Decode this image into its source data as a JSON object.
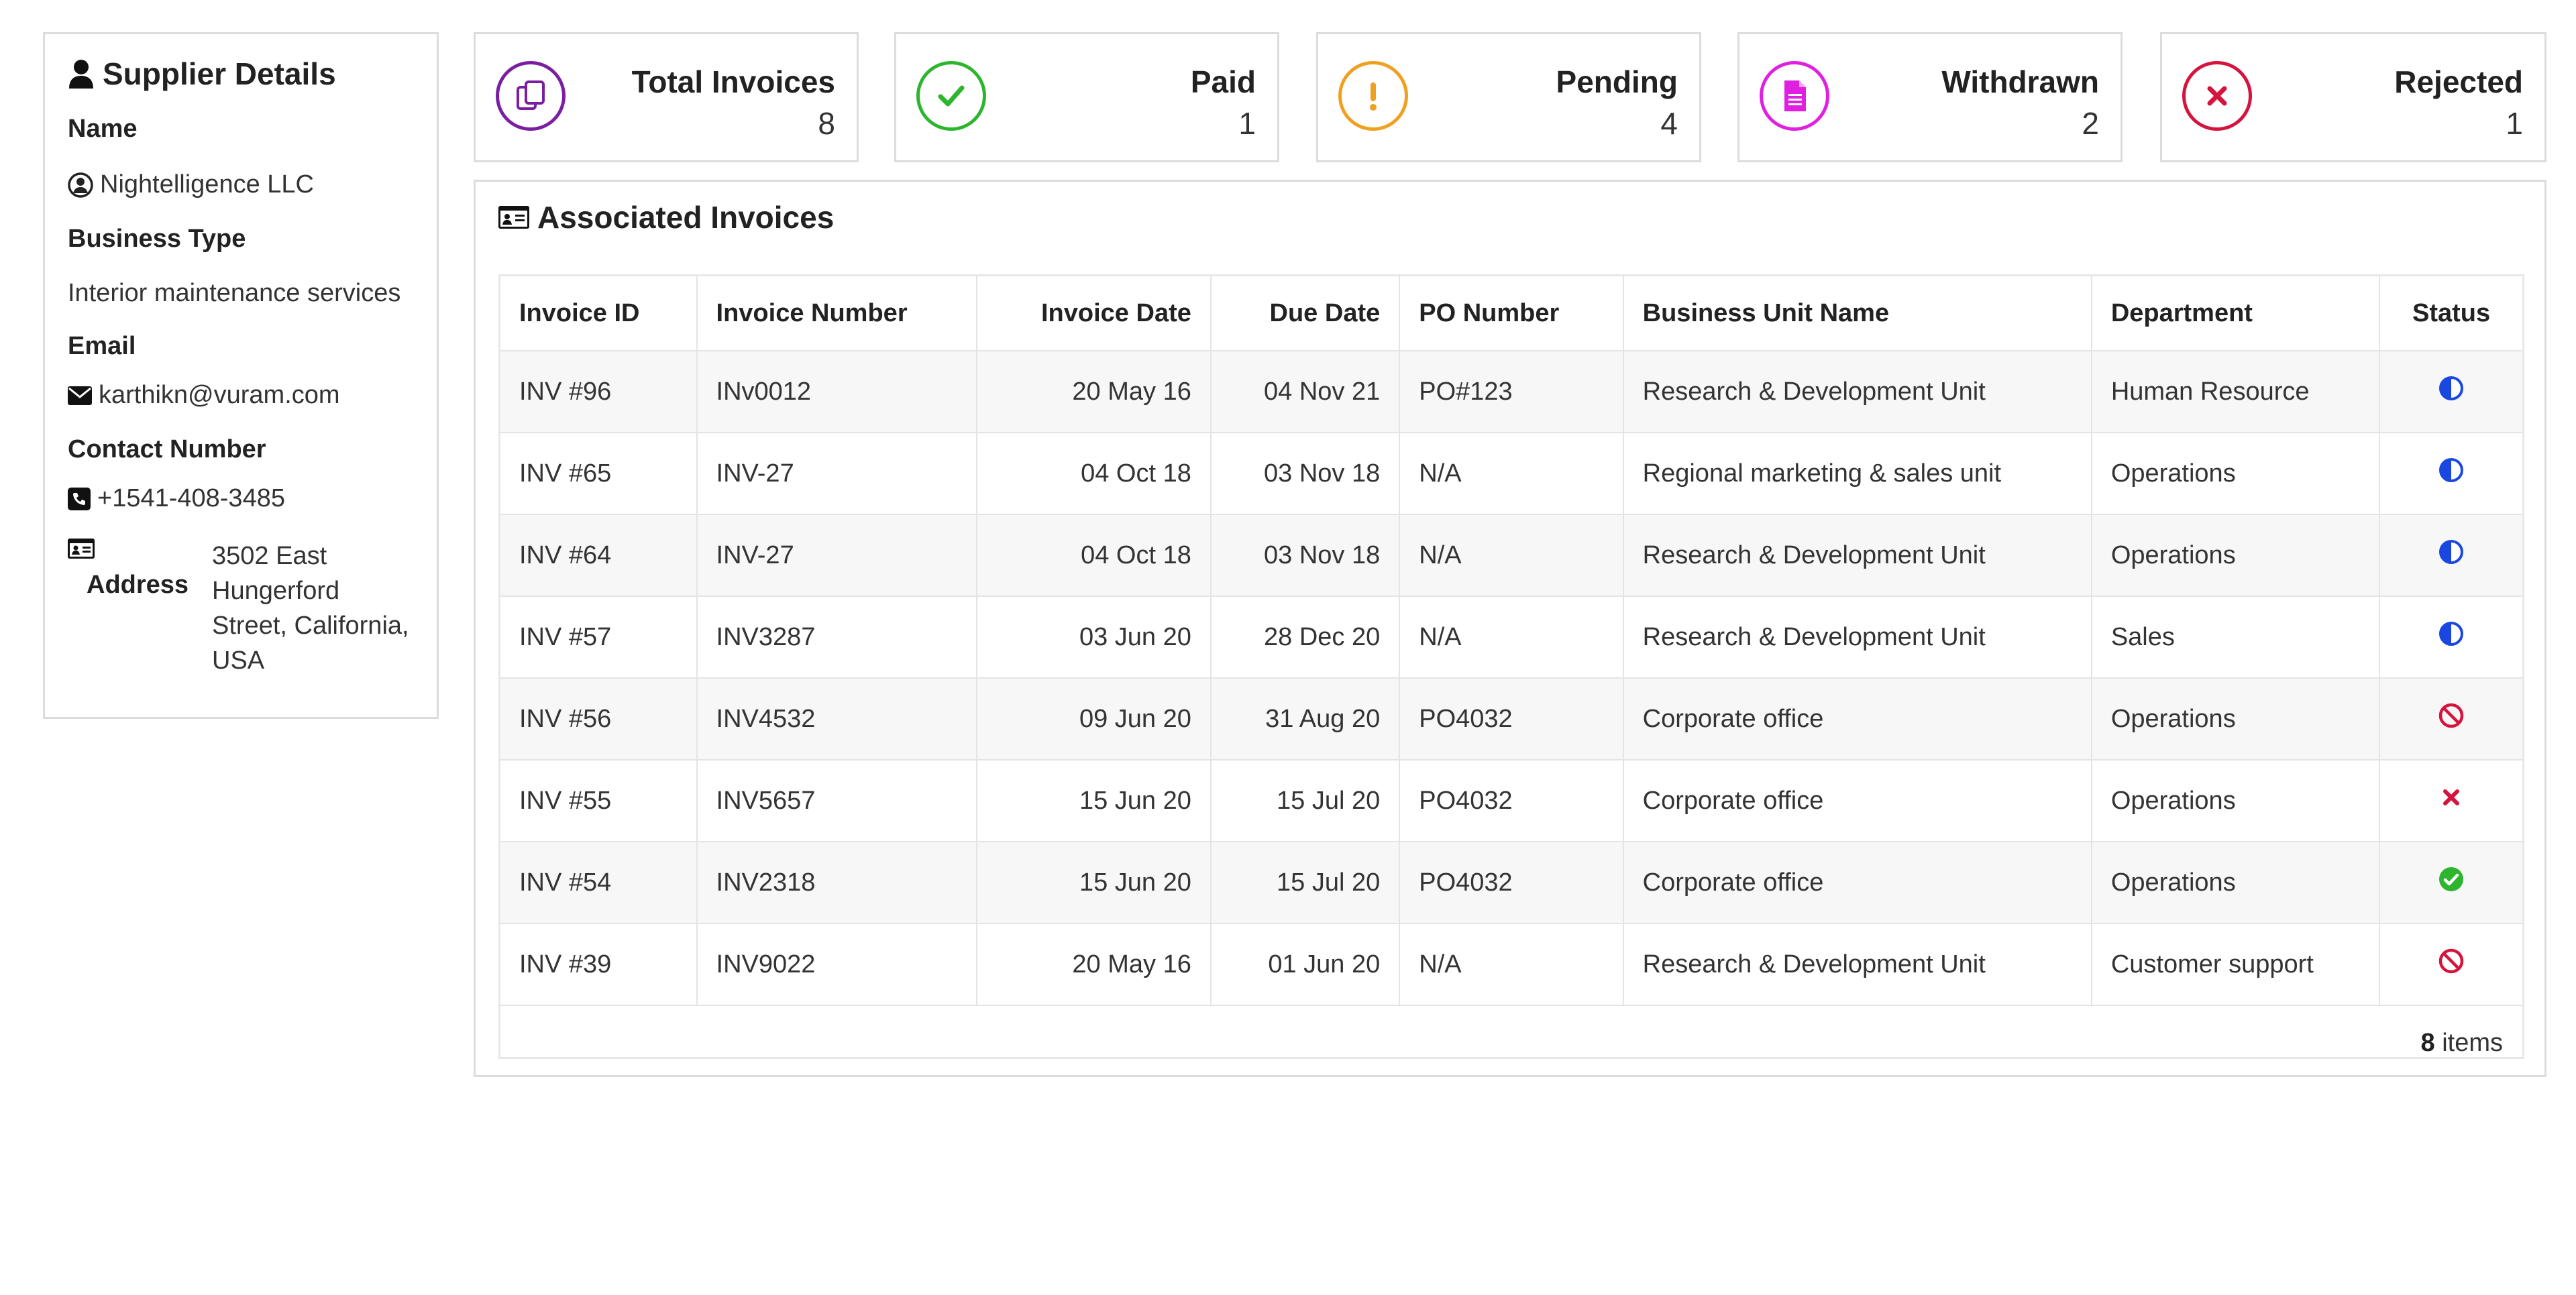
{
  "supplier": {
    "title": "Supplier Details",
    "name_label": "Name",
    "name": "Nightelligence LLC",
    "business_type_label": "Business Type",
    "business_type": "Interior maintenance services",
    "email_label": "Email",
    "email": "karthikn@vuram.com",
    "contact_label": "Contact Number",
    "contact": "+1541-408-3485",
    "address_label": "Address",
    "address_lines": [
      "3502 East",
      "Hungerford",
      "Street, California,",
      "USA"
    ]
  },
  "stats": [
    {
      "title": "Total Invoices",
      "count": "8",
      "color": "#7b1fa2",
      "icon": "copy-icon"
    },
    {
      "title": "Paid",
      "count": "1",
      "color": "#2db52d",
      "icon": "check-icon"
    },
    {
      "title": "Pending",
      "count": "4",
      "color": "#f0a020",
      "icon": "exclamation-icon"
    },
    {
      "title": "Withdrawn",
      "count": "2",
      "color": "#e020e0",
      "icon": "document-icon"
    },
    {
      "title": "Rejected",
      "count": "1",
      "color": "#d4143c",
      "icon": "x-icon"
    }
  ],
  "invoices": {
    "title": "Associated Invoices",
    "columns": [
      "Invoice ID",
      "Invoice Number",
      "Invoice Date",
      "Due Date",
      "PO Number",
      "Business Unit Name",
      "Department",
      "Status"
    ],
    "rows": [
      {
        "id": "INV #96",
        "number": "INv0012",
        "invoice_date": "20 May 16",
        "due_date": "04 Nov 21",
        "po": "PO#123",
        "unit": "Research & Development Unit",
        "dept": "Human Resource",
        "status": "half-circle-icon"
      },
      {
        "id": "INV #65",
        "number": "INV-27",
        "invoice_date": "04 Oct 18",
        "due_date": "03 Nov 18",
        "po": "N/A",
        "unit": "Regional marketing & sales unit",
        "dept": "Operations",
        "status": "half-circle-icon"
      },
      {
        "id": "INV #64",
        "number": "INV-27",
        "invoice_date": "04 Oct 18",
        "due_date": "03 Nov 18",
        "po": "N/A",
        "unit": "Research & Development Unit",
        "dept": "Operations",
        "status": "half-circle-icon"
      },
      {
        "id": "INV #57",
        "number": "INV3287",
        "invoice_date": "03 Jun 20",
        "due_date": "28 Dec 20",
        "po": "N/A",
        "unit": "Research & Development Unit",
        "dept": "Sales",
        "status": "half-circle-icon"
      },
      {
        "id": "INV #56",
        "number": "INV4532",
        "invoice_date": "09 Jun 20",
        "due_date": "31 Aug 20",
        "po": "PO4032",
        "unit": "Corporate office",
        "dept": "Operations",
        "status": "ban-icon"
      },
      {
        "id": "INV #55",
        "number": "INV5657",
        "invoice_date": "15 Jun 20",
        "due_date": "15 Jul 20",
        "po": "PO4032",
        "unit": "Corporate office",
        "dept": "Operations",
        "status": "x-mark-icon"
      },
      {
        "id": "INV #54",
        "number": "INV2318",
        "invoice_date": "15 Jun 20",
        "due_date": "15 Jul 20",
        "po": "PO4032",
        "unit": "Corporate office",
        "dept": "Operations",
        "status": "check-circle-icon"
      },
      {
        "id": "INV #39",
        "number": "INV9022",
        "invoice_date": "20 May 16",
        "due_date": "01 Jun 20",
        "po": "N/A",
        "unit": "Research & Development Unit",
        "dept": "Customer support",
        "status": "ban-icon"
      }
    ],
    "footer_count": "8",
    "footer_label": " items"
  }
}
